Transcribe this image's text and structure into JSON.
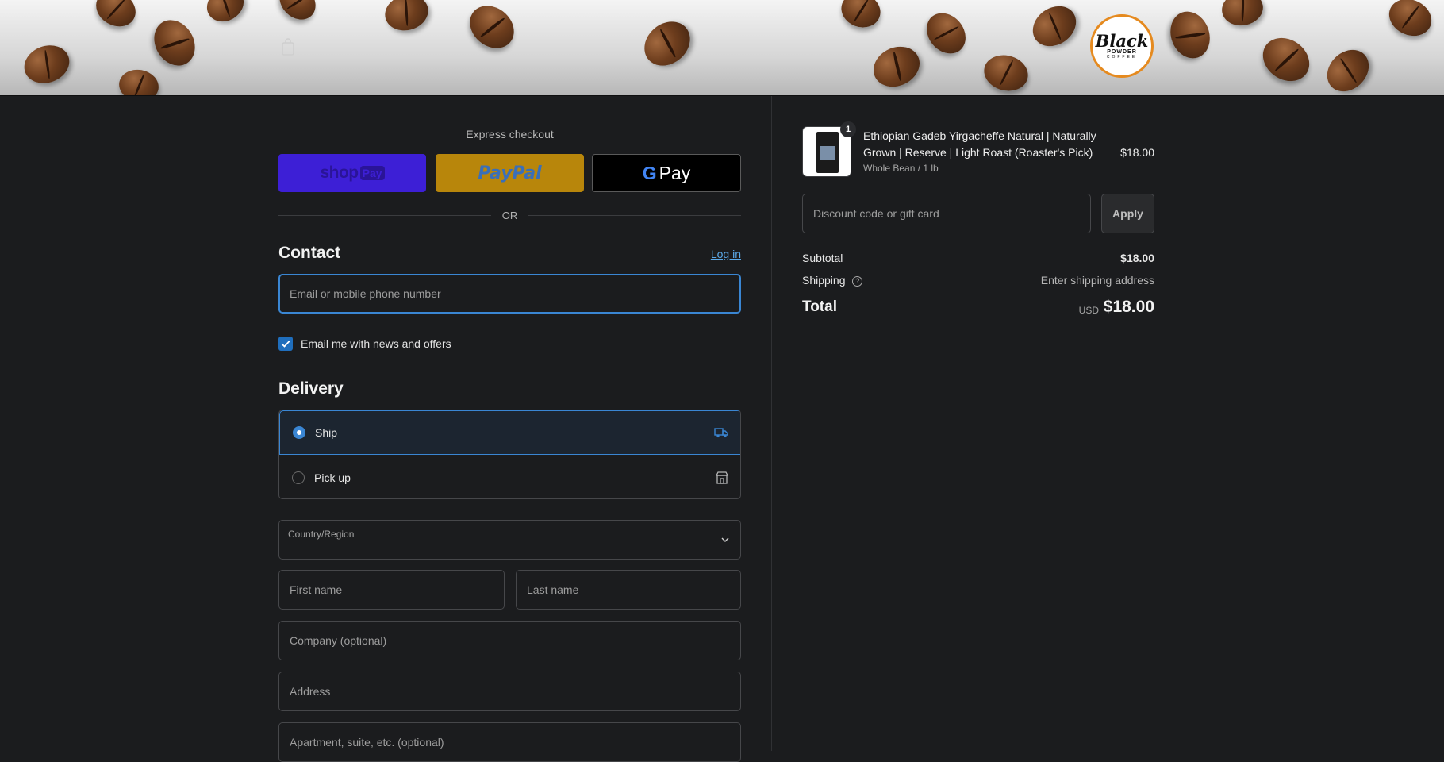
{
  "header": {
    "brand_main": "Black",
    "brand_sub": "POWDER",
    "brand_sub2": "COFFEE"
  },
  "express": {
    "title": "Express checkout",
    "shop_word": "shop",
    "shop_pay": "Pay",
    "paypal": "PayPal",
    "gpay_g": "G",
    "gpay_word": "Pay",
    "or": "OR"
  },
  "contact": {
    "title": "Contact",
    "login": "Log in",
    "email_placeholder": "Email or mobile phone number",
    "newsletter": "Email me with news and offers"
  },
  "delivery": {
    "title": "Delivery",
    "options": [
      {
        "label": "Ship",
        "selected": true,
        "icon": "truck-icon"
      },
      {
        "label": "Pick up",
        "selected": false,
        "icon": "store-icon"
      }
    ],
    "country_label": "Country/Region",
    "first_name": "First name",
    "last_name": "Last name",
    "company": "Company (optional)",
    "address": "Address",
    "apartment": "Apartment, suite, etc. (optional)"
  },
  "summary": {
    "product": {
      "name": "Ethiopian Gadeb Yirgacheffe Natural | Naturally Grown | Reserve | Light Roast (Roaster's Pick)",
      "variant": "Whole Bean / 1 lb",
      "price": "$18.00",
      "quantity": "1"
    },
    "discount_placeholder": "Discount code or gift card",
    "apply": "Apply",
    "subtotal_label": "Subtotal",
    "subtotal_value": "$18.00",
    "shipping_label": "Shipping",
    "shipping_value": "Enter shipping address",
    "total_label": "Total",
    "currency": "USD",
    "total_value": "$18.00"
  },
  "colors": {
    "background": "#1b1c1e",
    "accent": "#3a86d3",
    "shop_pay": "#3d1fd6",
    "paypal": "#b8860b"
  }
}
